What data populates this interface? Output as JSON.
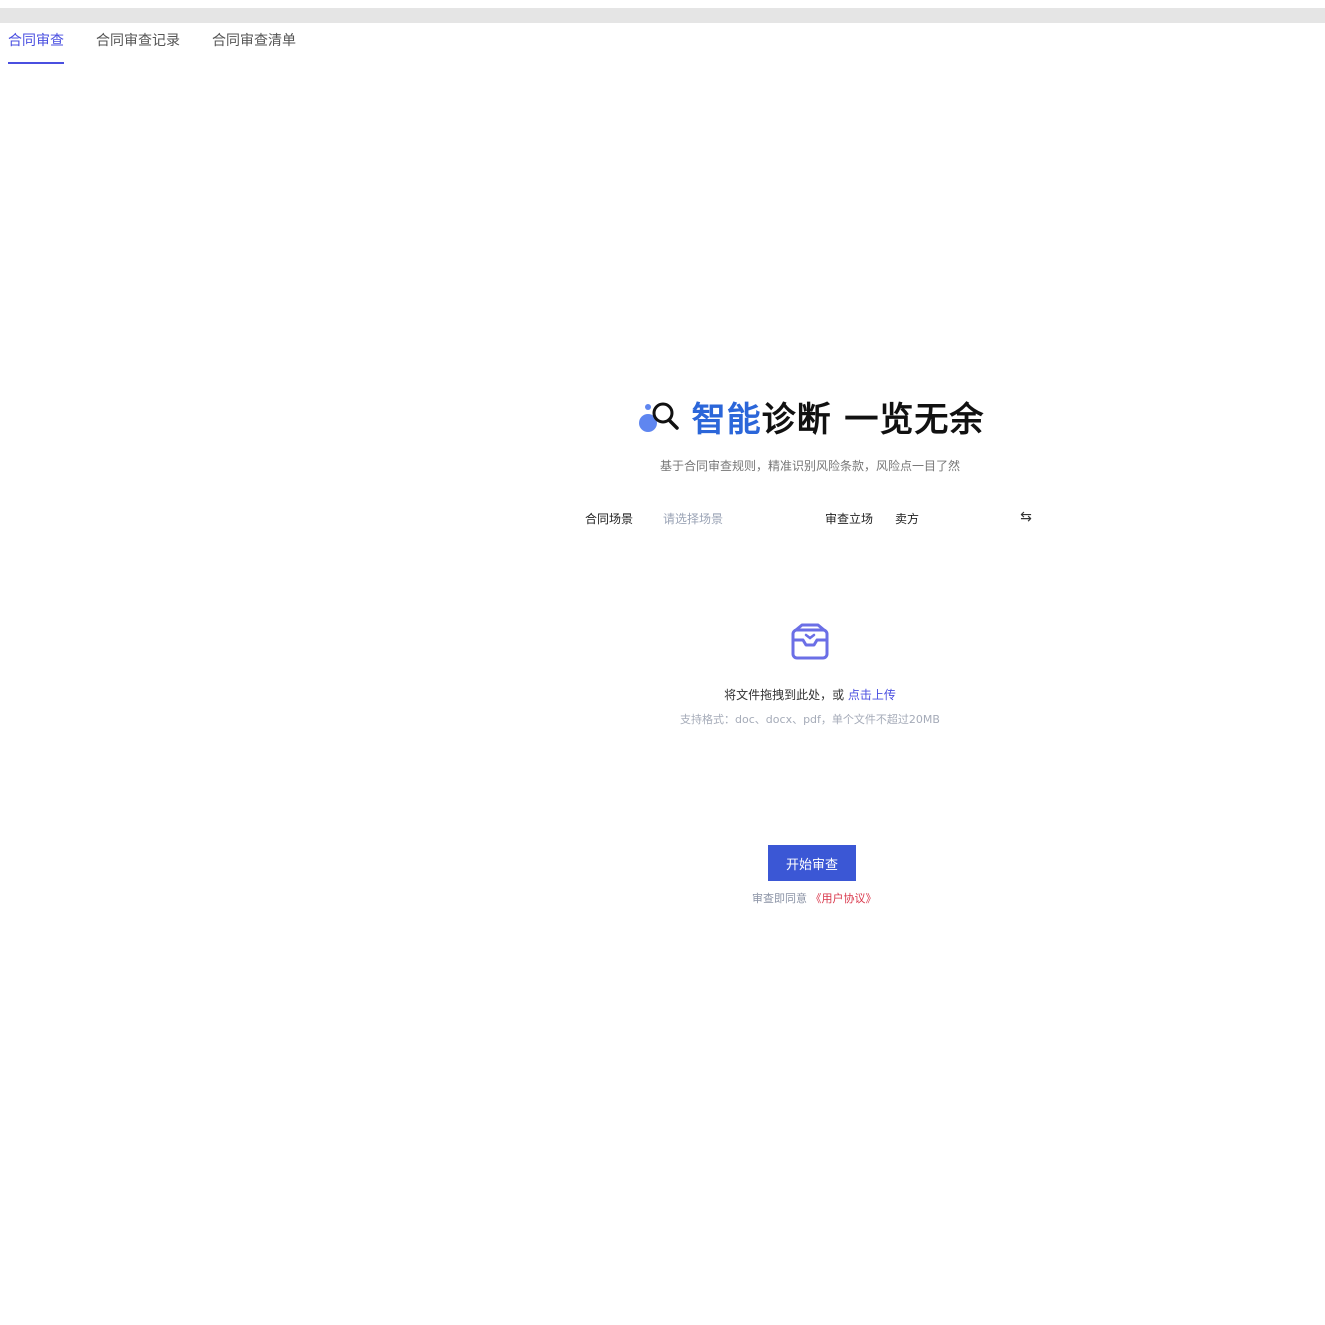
{
  "tabs": [
    {
      "label": "合同审查",
      "active": true
    },
    {
      "label": "合同审查记录",
      "active": false
    },
    {
      "label": "合同审查清单",
      "active": false
    }
  ],
  "hero": {
    "title_blue": "智能",
    "title_dark": "诊断 一览无余",
    "subtitle": "基于合同审查规则，精准识别风险条款，风险点一目了然"
  },
  "controls": {
    "scene_label": "合同场景",
    "scene_placeholder": "请选择场景",
    "stance_label": "审查立场",
    "stance_value": "卖方",
    "swap_symbol": "⇆"
  },
  "upload": {
    "main_text": "将文件拖拽到此处，或",
    "link_text": "点击上传",
    "hint": "支持格式：doc、docx、pdf，单个文件不超过20MB"
  },
  "actions": {
    "start_label": "开始审查",
    "agree_prefix": "审查即同意",
    "agree_link": "《用户协议》"
  },
  "colors": {
    "accent": "#4a4fe0",
    "button": "#3b57d5",
    "title_blue": "#2b66d9",
    "link_red": "#d9364a"
  }
}
